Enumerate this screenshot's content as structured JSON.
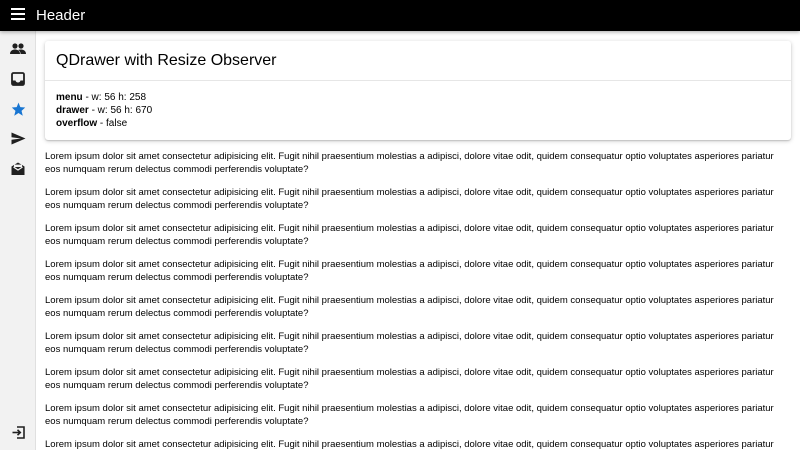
{
  "header": {
    "title": "Header",
    "menu_icon": "menu-icon"
  },
  "drawer": {
    "items": [
      {
        "icon": "people-icon",
        "color": "#202020"
      },
      {
        "icon": "inbox-icon",
        "color": "#202020"
      },
      {
        "icon": "star-icon",
        "color": "#1976d2"
      },
      {
        "icon": "send-icon",
        "color": "#202020"
      },
      {
        "icon": "drafts-icon",
        "color": "#202020"
      }
    ],
    "bottom_icon": "exit-icon"
  },
  "card": {
    "title": "QDrawer with Resize Observer",
    "rows": [
      {
        "label": "menu",
        "value": " - w: 56 h: 258"
      },
      {
        "label": "drawer",
        "value": " - w: 56 h: 670"
      },
      {
        "label": "overflow",
        "value": " - false"
      }
    ]
  },
  "lorem_text": "Lorem ipsum dolor sit amet consectetur adipisicing elit. Fugit nihil praesentium molestias a adipisci, dolore vitae odit, quidem consequatur optio voluptates asperiores pariatur eos numquam rerum delectus commodi perferendis voluptate?",
  "colors": {
    "header_bg": "#000000",
    "drawer_bg": "#f2f2f2",
    "accent": "#1976d2"
  }
}
